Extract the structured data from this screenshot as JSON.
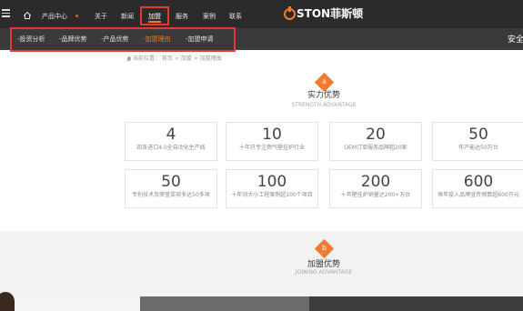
{
  "header": {
    "nav": [
      {
        "label": "产品中心"
      },
      {
        "label": "关于"
      },
      {
        "label": "新闻"
      },
      {
        "label": "加盟"
      },
      {
        "label": "服务"
      },
      {
        "label": "案例"
      },
      {
        "label": "联系"
      }
    ],
    "logo_text": "STON菲斯顿",
    "subnav": [
      {
        "label": "-投资分析"
      },
      {
        "label": "-品牌优势"
      },
      {
        "label": "-产品优势"
      },
      {
        "label": "-加盟理由"
      },
      {
        "label": "-加盟申请"
      }
    ],
    "subnav_right": "安全",
    "icons": [
      "menu-icon",
      "home-icon",
      "location-icon"
    ]
  },
  "breadcrumb": "当前位置： 首页 > 加盟 > 加盟理由",
  "sections": [
    {
      "badge": "a",
      "title": "实力优势",
      "subtitle": "STRENGTH ADVANTAGE"
    },
    {
      "badge": "b",
      "title": "加盟优势",
      "subtitle": "JOINING ADVANTAGE"
    }
  ],
  "stats": [
    {
      "num": "4",
      "desc": "四条进口4.0全自动化生产线"
    },
    {
      "num": "10",
      "desc": "十年只专注燃气壁挂炉行业"
    },
    {
      "num": "20",
      "desc": "OEM订单服务品牌超20家"
    },
    {
      "num": "50",
      "desc": "年产能达50万台"
    },
    {
      "num": "50",
      "desc": "专利技术及荣誉奖项多达50多项"
    },
    {
      "num": "100",
      "desc": "十年间大小工程案例超100个项目"
    },
    {
      "num": "200",
      "desc": "十年壁挂炉销量达200+万台"
    },
    {
      "num": "600",
      "desc": "每年投入品牌宣传预算超600万元"
    }
  ],
  "colors": {
    "accent": "#f07a2e",
    "highlight_frame": "#e53935",
    "topbar": "#2b2b2b",
    "subbar": "#3a3a3a"
  }
}
